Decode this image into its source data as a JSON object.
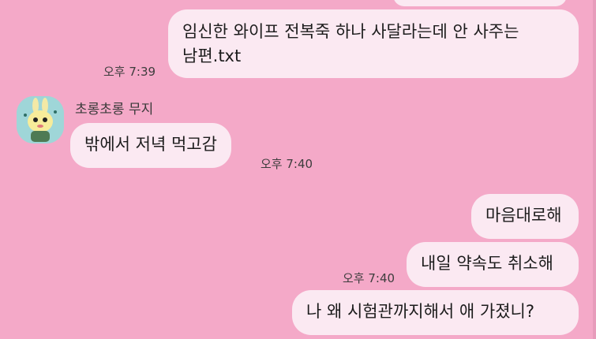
{
  "conversation": {
    "messages": [
      {
        "side": "right",
        "lines": [
          "임신한 와이프 전복죽 하나 사달라는데 안 사주는",
          "남편.txt"
        ],
        "time": "오후 7:39"
      },
      {
        "side": "left",
        "sender": "초롱초롱 무지",
        "avatar_icon": "muji-rabbit-avatar-icon",
        "text": "밖에서 저녁 먹고감",
        "time": "오후 7:40"
      },
      {
        "side": "right",
        "text": "마음대로해"
      },
      {
        "side": "right",
        "text": "내일 약속도 취소해",
        "time": "오후 7:40"
      },
      {
        "side": "right",
        "text": "나 왜 시험관까지해서 애 가졌니?"
      }
    ]
  },
  "colors": {
    "background": "#f4a9c8",
    "bubble": "#fbe9f2",
    "text": "#1c1c1c",
    "time": "#3d3d3d"
  }
}
